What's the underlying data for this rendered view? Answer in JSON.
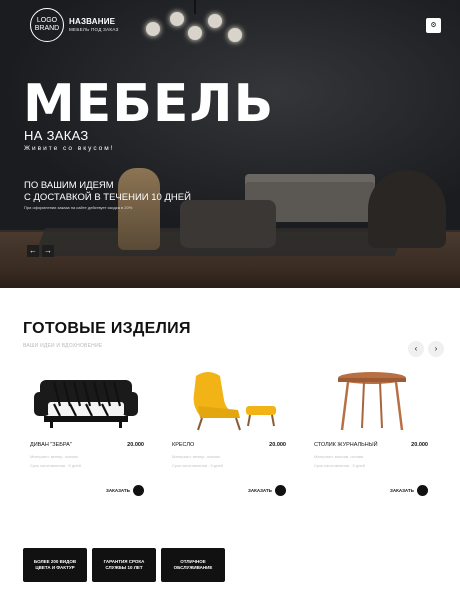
{
  "header": {
    "logo_line1": "LOGO",
    "logo_line2": "BRAND",
    "brand_name": "НАЗВАНИЕ",
    "brand_sub": "МЕБЕЛЬ ПОД ЗАКАЗ",
    "menu_icon": "gear-icon"
  },
  "hero": {
    "title": "МЕБЕЛЬ",
    "subtitle": "НА ЗАКАЗ",
    "slogan": "Живите со вкусом!",
    "line1": "ПО ВАШИМ ИДЕЯМ",
    "line2": "С ДОСТАВКОЙ В ТЕЧЕНИИ 10 ДНЕЙ",
    "small": "При оформлении заказа на сайте действует скидка в 20%",
    "prev_arrow": "←",
    "next_arrow": "→"
  },
  "products": {
    "title": "ГОТОВЫЕ ИЗДЕЛИЯ",
    "subtitle": "ВАШИ ИДЕИ И ВДОХНОВЕНИЕ",
    "prev": "‹",
    "next": "›",
    "items": [
      {
        "name": "ДИВАН \"ЗЕБРА\"",
        "price": "20.000",
        "desc1": "Материал: велюр, основа",
        "desc2": "Срок изготовления - 5 дней",
        "order": "ЗАКАЗАТЬ"
      },
      {
        "name": "КРЕСЛО",
        "price": "20.000",
        "desc1": "Материал: велюр, основа",
        "desc2": "Срок изготовления - 5 дней",
        "order": "ЗАКАЗАТЬ"
      },
      {
        "name": "СТОЛИК ЖУРНАЛЬНЫЙ",
        "price": "20.000",
        "desc1": "Материал: массив, основа",
        "desc2": "Срок изготовления - 5 дней",
        "order": "ЗАКАЗАТЬ"
      }
    ]
  },
  "features": [
    {
      "label": "БОЛЕЕ 200 ВИДОВ ЦВЕТА И ФАКТУР"
    },
    {
      "label": "ГАРАНТИЯ СРОКА СЛУЖБЫ 10 ЛЕТ"
    },
    {
      "label": "ОТЛИЧНОЕ ОБСЛУЖИВАНИЕ"
    }
  ],
  "colors": {
    "accent": "#111111",
    "chair_yellow": "#f2b317",
    "wood": "#b86f43"
  }
}
